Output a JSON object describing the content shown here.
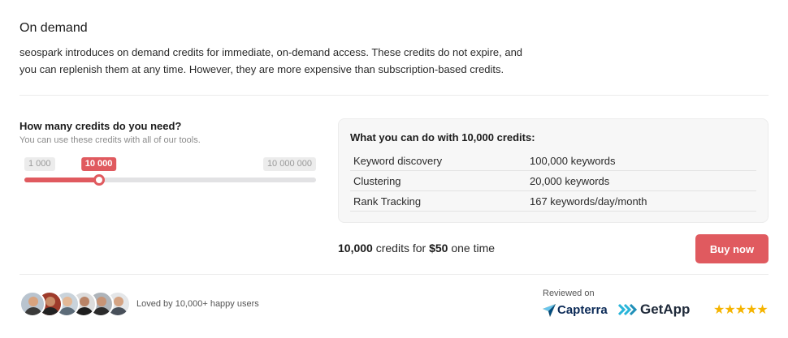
{
  "header": {
    "title": "On demand",
    "description": "seospark introduces on demand credits for immediate, on-demand access. These credits do not expire, and you can replenish them at any time. However, they are more expensive than subscription-based credits."
  },
  "calculator": {
    "question": "How many credits do you need?",
    "subtitle": "You can use these credits with all of our tools.",
    "slider": {
      "min_label": "1 000",
      "max_label": "10 000 000",
      "current_label": "10 000",
      "level": 0.255,
      "accent": "#e05a5f"
    }
  },
  "info_card": {
    "title": "What you can do with 10,000 credits:",
    "rows": [
      {
        "label": "Keyword discovery",
        "value": "100,000 keywords"
      },
      {
        "label": "Clustering",
        "value": "20,000 keywords"
      },
      {
        "label": "Rank Tracking",
        "value": "167 keywords/day/month"
      }
    ]
  },
  "pricing": {
    "credits": "10,000",
    "credits_suffix": " credits for ",
    "price": "$50",
    "price_suffix": " one time",
    "buy_label": "Buy now"
  },
  "footer": {
    "loved_text": "Loved by 10,000+ happy users",
    "reviewed_label": "Reviewed on",
    "capterra": "Capterra",
    "getapp": "GetApp",
    "stars": "★★★★★",
    "avatars": [
      {
        "bg": "#b9c4cf",
        "skin": "#d8a37f",
        "shirt": "#3a3a3a"
      },
      {
        "bg": "#9e3b2b",
        "skin": "#c98c68",
        "shirt": "#222222"
      },
      {
        "bg": "#c9d3db",
        "skin": "#e3b896",
        "shirt": "#5c6b78"
      },
      {
        "bg": "#dcdcdc",
        "skin": "#b98366",
        "shirt": "#1e1e1e"
      },
      {
        "bg": "#aeb4ba",
        "skin": "#c79476",
        "shirt": "#2b2b2b"
      },
      {
        "bg": "#e4e6e8",
        "skin": "#d4a383",
        "shirt": "#48505a"
      }
    ]
  }
}
